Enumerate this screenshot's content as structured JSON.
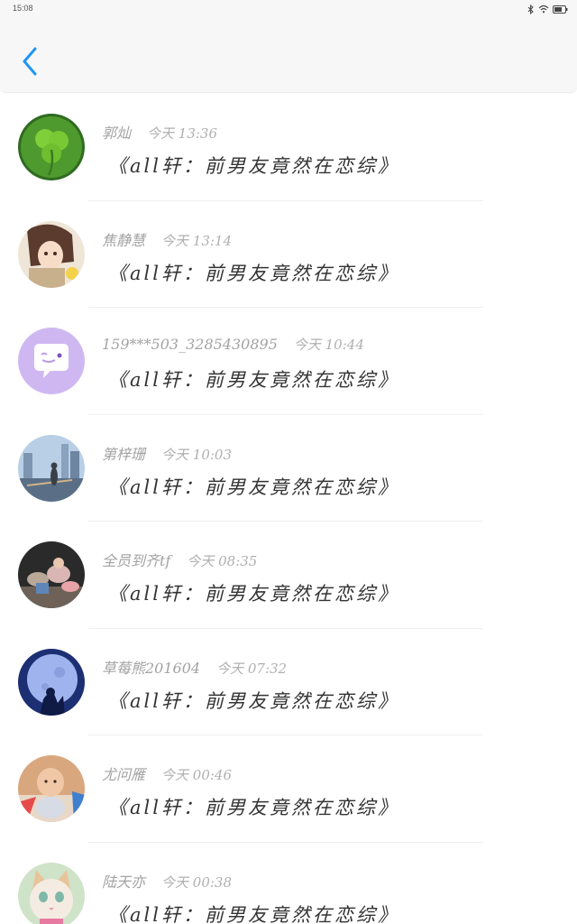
{
  "status_bar": {
    "time": "15:08",
    "icons": [
      "bluetooth-icon",
      "wifi-icon",
      "battery-icon"
    ]
  },
  "header": {
    "back_icon": "chevron-left-icon",
    "accent_color": "#2196F3"
  },
  "comments": [
    {
      "name": "郭灿",
      "time": "今天 13:36",
      "message": "《all轩：前男友竟然在恋综》",
      "avatar": "clover-avatar"
    },
    {
      "name": "焦静慧",
      "time": "今天 13:14",
      "message": "《all轩：前男友竟然在恋综》",
      "avatar": "anime-avatar"
    },
    {
      "name": "159***503_3285430895",
      "time": "今天 10:44",
      "message": "《all轩：前男友竟然在恋综》",
      "avatar": "default-chat-avatar"
    },
    {
      "name": "第梓珊",
      "time": "今天 10:03",
      "message": "《all轩：前男友竟然在恋综》",
      "avatar": "city-photo-avatar"
    },
    {
      "name": "全员到齐tf",
      "time": "今天 08:35",
      "message": "《all轩：前男友竟然在恋综》",
      "avatar": "group-photo-avatar"
    },
    {
      "name": "草莓熊201604",
      "time": "今天 07:32",
      "message": "《all轩：前男友竟然在恋综》",
      "avatar": "moon-avatar"
    },
    {
      "name": "尤问雁",
      "time": "今天 00:46",
      "message": "《all轩：前男友竟然在恋综》",
      "avatar": "baby-avatar"
    },
    {
      "name": "陆天亦",
      "time": "今天 00:38",
      "message": "《all轩：前男友竟然在恋综》",
      "avatar": "cat-avatar"
    }
  ]
}
